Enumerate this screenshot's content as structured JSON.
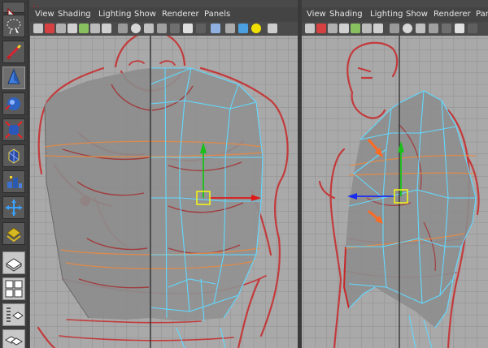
{
  "left_panel": {
    "menu": [
      "View",
      "Shading",
      "Lighting",
      "Show",
      "Renderer",
      "Panels"
    ]
  },
  "right_panel": {
    "menu": [
      "View",
      "Shading",
      "Lighting",
      "Show",
      "Renderer",
      "Panels"
    ]
  },
  "toolbox": {
    "tools": [
      "select-tool",
      "lasso-tool",
      "paint-tool",
      "move-tool",
      "rotate-tool",
      "scale-tool",
      "universal-manipulator",
      "soft-modify-tool",
      "show-manipulator",
      "last-tool"
    ],
    "layouts": [
      "single-pane-layout",
      "four-pane-layout",
      "outliner-layout",
      "two-pane-layout"
    ]
  },
  "colors": {
    "viewport_bg": "#a9a9a9",
    "grid_line": "#8f8f8f",
    "mesh_fill": "#8a8a8a",
    "wire_selected": "#62d9ff",
    "sketch_red": "#c8282a",
    "edge_loop_orange": "#e08a4a",
    "axis_y": "#19c019",
    "axis_x": "#e01818",
    "axis_z": "#1a2cf0",
    "center_handle": "#f2f21a",
    "annotation_arrow": "#ff6a22"
  }
}
